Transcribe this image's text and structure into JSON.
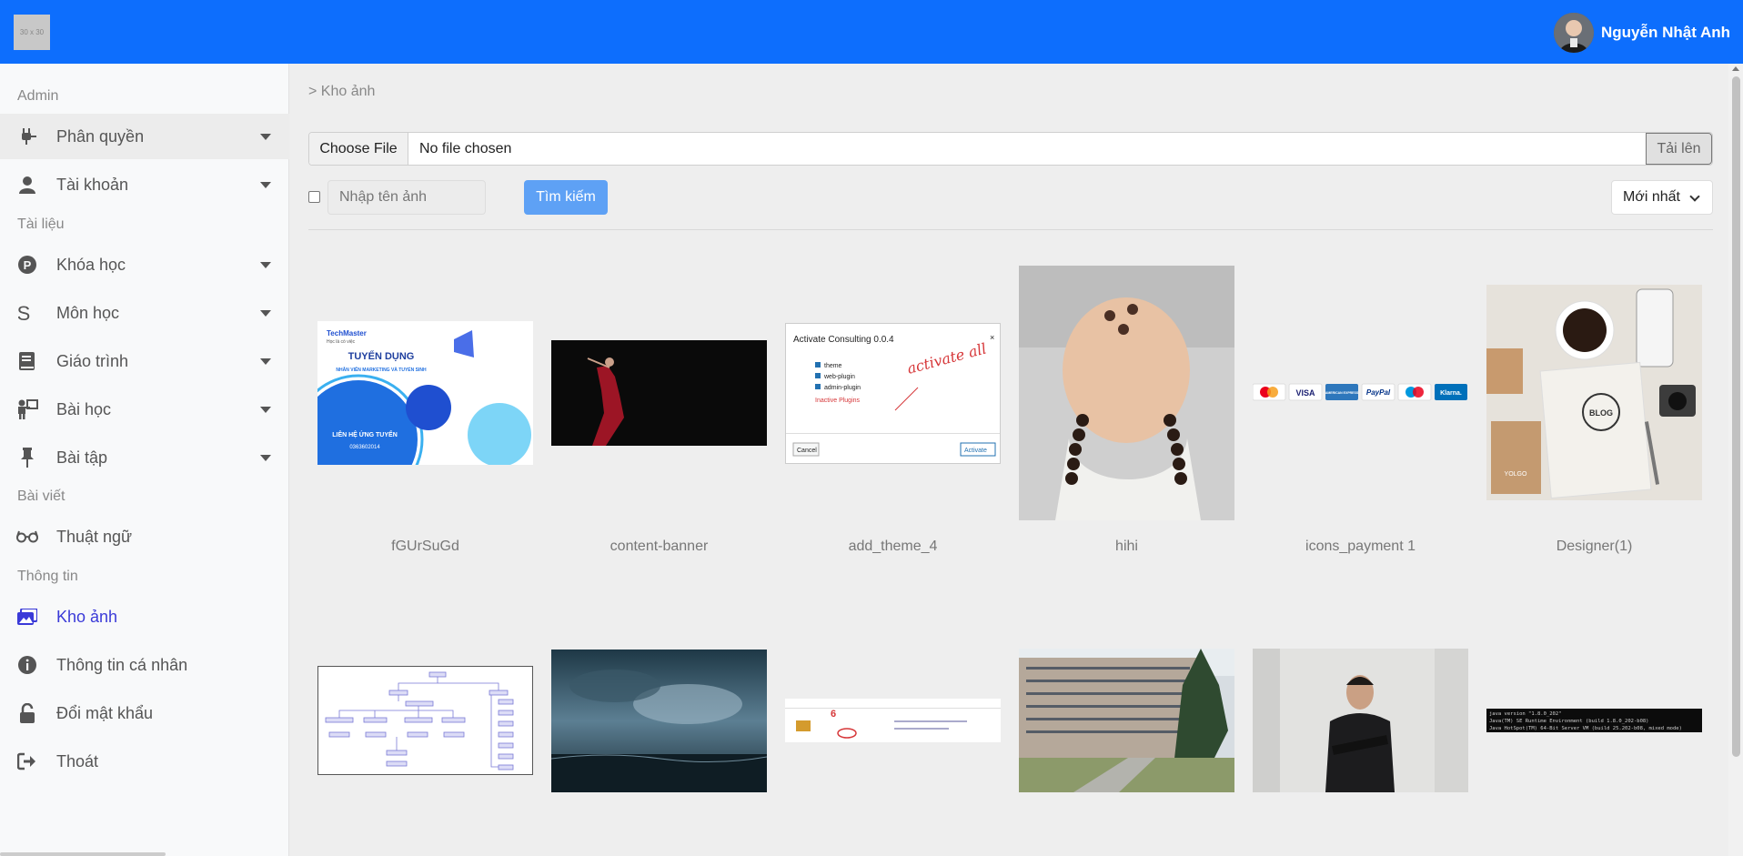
{
  "header": {
    "logo_text": "30 x 30",
    "user_name": "Nguyễn Nhật Anh"
  },
  "sidebar": {
    "sections": {
      "admin": "Admin",
      "documents": "Tài liệu",
      "posts": "Bài viết",
      "info": "Thông tin"
    },
    "items": [
      {
        "label": "Phân quyền",
        "icon": "plug-icon"
      },
      {
        "label": "Tài khoản",
        "icon": "user-icon"
      },
      {
        "label": "Khóa học",
        "icon": "product-hunt-icon"
      },
      {
        "label": "Môn học",
        "icon": "s-letter-icon"
      },
      {
        "label": "Giáo trình",
        "icon": "book-icon"
      },
      {
        "label": "Bài học",
        "icon": "teacher-icon"
      },
      {
        "label": "Bài tập",
        "icon": "thumbtack-icon"
      },
      {
        "label": "Thuật ngữ",
        "icon": "glasses-icon"
      },
      {
        "label": "Kho ảnh",
        "icon": "images-icon"
      },
      {
        "label": "Thông tin cá nhân",
        "icon": "info-circle-icon"
      },
      {
        "label": "Đổi mật khẩu",
        "icon": "unlock-icon"
      },
      {
        "label": "Thoát",
        "icon": "sign-out-icon"
      }
    ]
  },
  "main": {
    "breadcrumb": "> Kho ảnh",
    "file_input": {
      "button_label": "Choose File",
      "status": "No file chosen",
      "upload_label": "Tải lên"
    },
    "search": {
      "placeholder": "Nhập tên ảnh",
      "button_label": "Tìm kiếm"
    },
    "sort": {
      "selected": "Mới nhất"
    },
    "images": [
      {
        "caption": "fGUrSuGd"
      },
      {
        "caption": "content-banner"
      },
      {
        "caption": "add_theme_4"
      },
      {
        "caption": "hihi"
      },
      {
        "caption": "icons_payment 1"
      },
      {
        "caption": "Designer(1)"
      },
      {
        "caption": ""
      },
      {
        "caption": ""
      },
      {
        "caption": ""
      },
      {
        "caption": ""
      },
      {
        "caption": ""
      },
      {
        "caption": ""
      }
    ],
    "thumb_texts": {
      "techmaster_brand": "TechMaster",
      "techmaster_slogan": "Học là có việc",
      "techmaster_title": "TUYỂN DỤNG",
      "techmaster_sub": "NHÂN VIÊN MARKETING VÀ TUYỂN SINH",
      "techmaster_contact": "LIÊN HỆ ỨNG TUYỂN",
      "techmaster_phone": "0363602014",
      "plugin_title": "Activate Consulting 0.0.4",
      "plugin_opt1": "theme",
      "plugin_opt2": "web-plugin",
      "plugin_opt3": "admin-plugin",
      "plugin_inactive": "Inactive Plugins",
      "plugin_cancel": "Cancel",
      "plugin_activate": "Activate",
      "plugin_handwriting": "activate all",
      "pay_visa": "VISA",
      "pay_amex": "AMERICAN EXPRESS",
      "pay_paypal": "PayPal",
      "pay_klarna": "Klarna.",
      "blog_word": "BLOG",
      "yolgo_word": "YOLGO",
      "java_line1": "java version \"1.8.0_202\"",
      "java_line2": "Java(TM) SE Runtime Environment (build 1.8.0_202-b08)",
      "java_line3": "Java HotSpot(TM) 64-Bit Server VM (build 25.202-b08, mixed mode)"
    }
  }
}
